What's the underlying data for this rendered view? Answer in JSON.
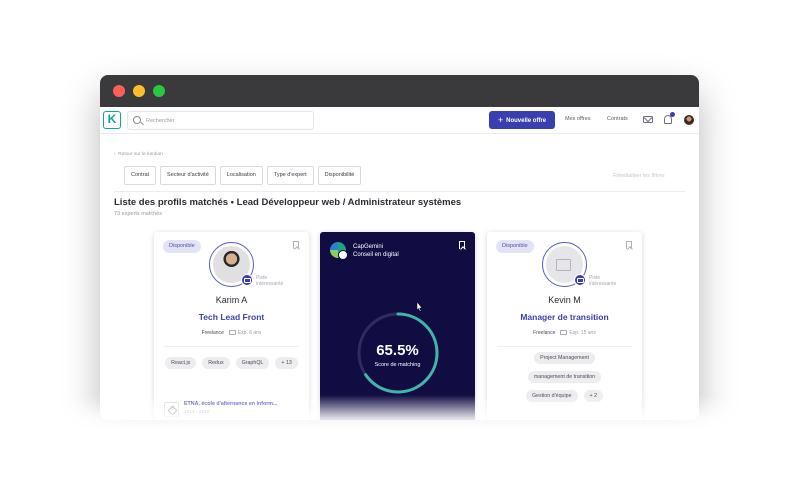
{
  "titlebar": {
    "buttons": [
      "close",
      "minimize",
      "maximize"
    ]
  },
  "topnav": {
    "logo_letter": "K",
    "search_placeholder": "Rechercher",
    "new_offer_label": "Nouvelle offre",
    "my_offers": "Mes offres",
    "contracts": "Contrats",
    "icons": [
      "mail-icon",
      "bell-icon",
      "user-avatar"
    ]
  },
  "back_link": "Retour sur le kanban",
  "filters": [
    "Contrat",
    "Secteur d'activité",
    "Localisation",
    "Type d'expert",
    "Disponibilité"
  ],
  "reset_filters": "Réinitialiser les filtres",
  "page_title": "Liste des profils matchés • Lead Développeur web / Administrateur systèmes",
  "experts_count": "73 experts matchés",
  "cards": [
    {
      "badge": "Disponible",
      "piste_line1": "Piste",
      "piste_line2": "intéressante",
      "name": "Karim A",
      "role": "Tech Lead Front",
      "contract": "Freelance",
      "experience": "Exp. 6 ans",
      "tags": [
        "React.js",
        "Redux",
        "GraphQL",
        "+ 13"
      ],
      "school_name": "ETNA, école d'alternance en inform...",
      "school_years": "2014 - 2016"
    },
    {
      "company_line1": "CapGemini",
      "company_line2": "Conseil en digital",
      "score_value": 65.5,
      "score_text": "65.5%",
      "score_label": "Score de matching",
      "gauge_colors": {
        "track": "#2e2d60",
        "fill": "#3fb6a8"
      }
    },
    {
      "badge": "Disponible",
      "piste_line1": "Piste",
      "piste_line2": "intéressante",
      "name": "Kevin M",
      "role": "Manager de transition",
      "contract": "Freelance",
      "experience": "Exp. 15 ans",
      "tags": [
        "Project Management",
        "management de transition",
        "Gestion d'équipe",
        "+ 2"
      ]
    }
  ],
  "colors": {
    "accent": "#3a3fb0",
    "brand_teal": "#14a39a",
    "dark_card": "#110d43"
  }
}
